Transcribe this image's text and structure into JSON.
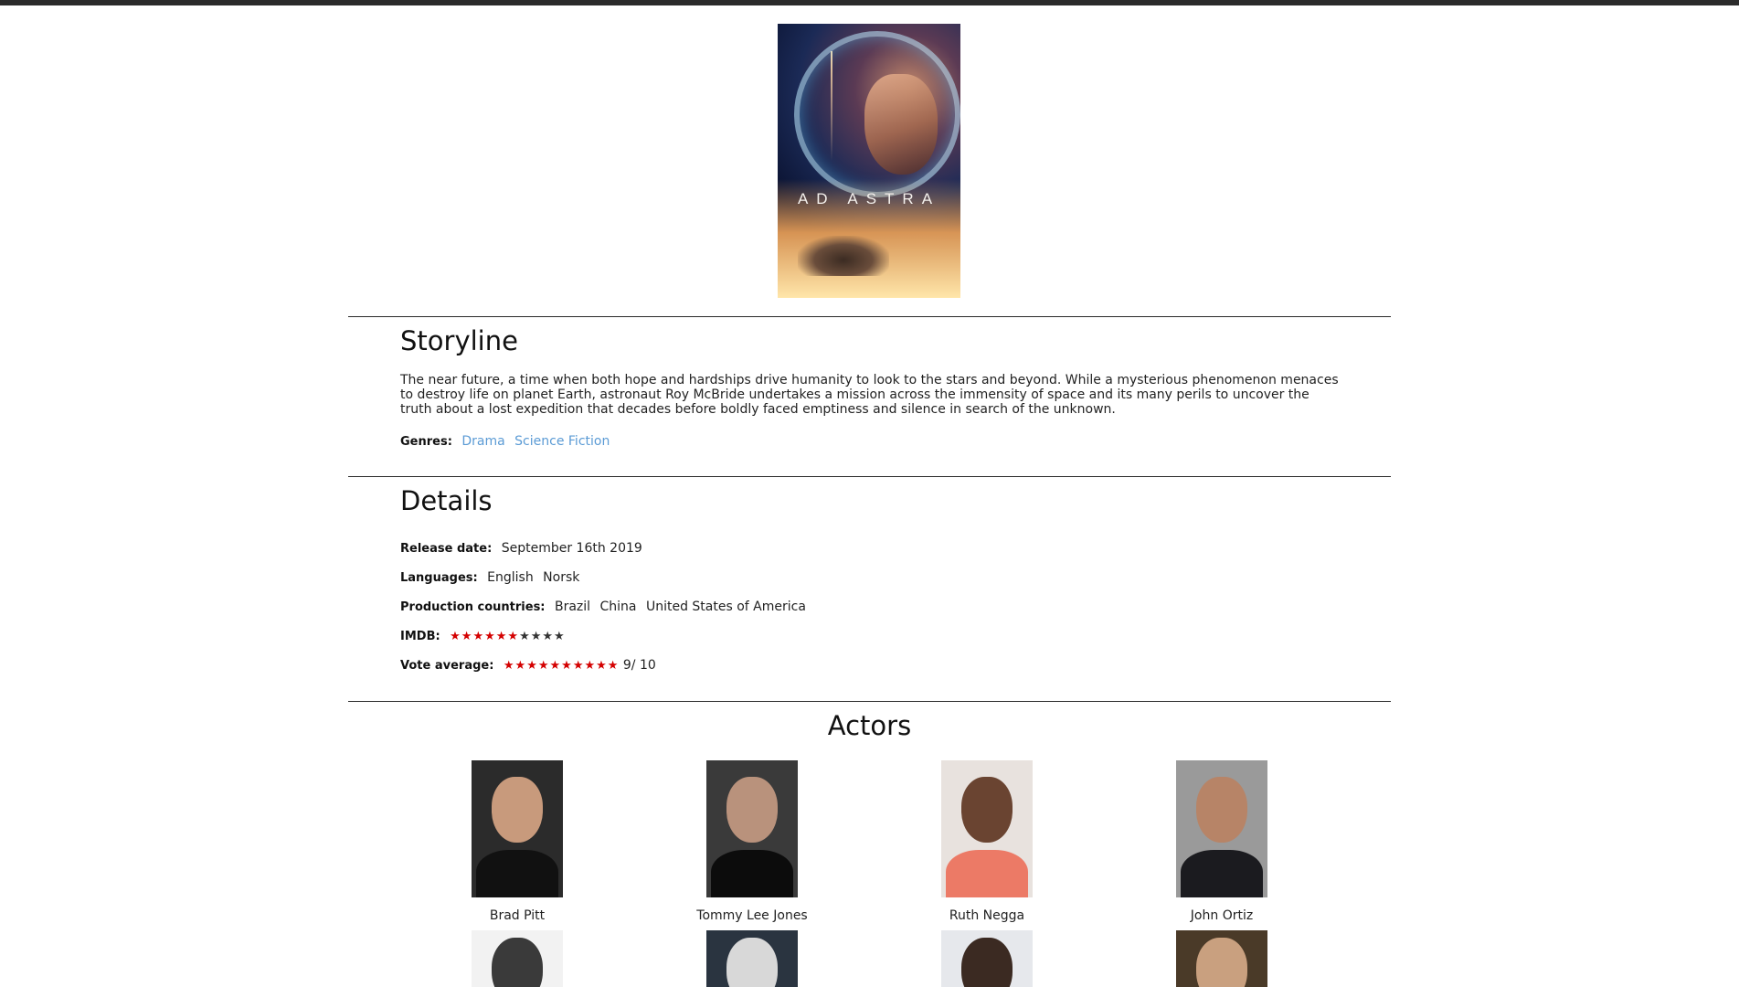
{
  "poster": {
    "title_text": "AD ASTRA"
  },
  "storyline": {
    "heading": "Storyline",
    "text": "The near future, a time when both hope and hardships drive humanity to look to the stars and beyond. While a mysterious phenomenon menaces to destroy life on planet Earth, astronaut Roy McBride undertakes a mission across the immensity of space and its many perils to uncover the truth about a lost expedition that decades before boldly faced emptiness and silence in search of the unknown.",
    "genres_label": "Genres:",
    "genres": [
      "Drama",
      "Science Fiction"
    ]
  },
  "details": {
    "heading": "Details",
    "release_label": "Release date:",
    "release_value": "September 16th 2019",
    "languages_label": "Languages:",
    "languages": [
      "English",
      "Norsk"
    ],
    "countries_label": "Production countries:",
    "countries": [
      "Brazil",
      "China",
      "United States of America"
    ],
    "imdb_label": "IMDB:",
    "imdb_stars_filled": 6,
    "imdb_stars_total": 10,
    "vote_label": "Vote average:",
    "vote_stars_filled": 10,
    "vote_stars_total": 10,
    "vote_text": "9/ 10"
  },
  "actors": {
    "heading": "Actors",
    "list": [
      {
        "name": "Brad Pitt"
      },
      {
        "name": "Tommy Lee Jones"
      },
      {
        "name": "Ruth Negga"
      },
      {
        "name": "John Ortiz"
      }
    ]
  },
  "colors": {
    "genre_link": "#5b9bd5",
    "star_filled": "#d40000",
    "star_empty": "#333333"
  }
}
